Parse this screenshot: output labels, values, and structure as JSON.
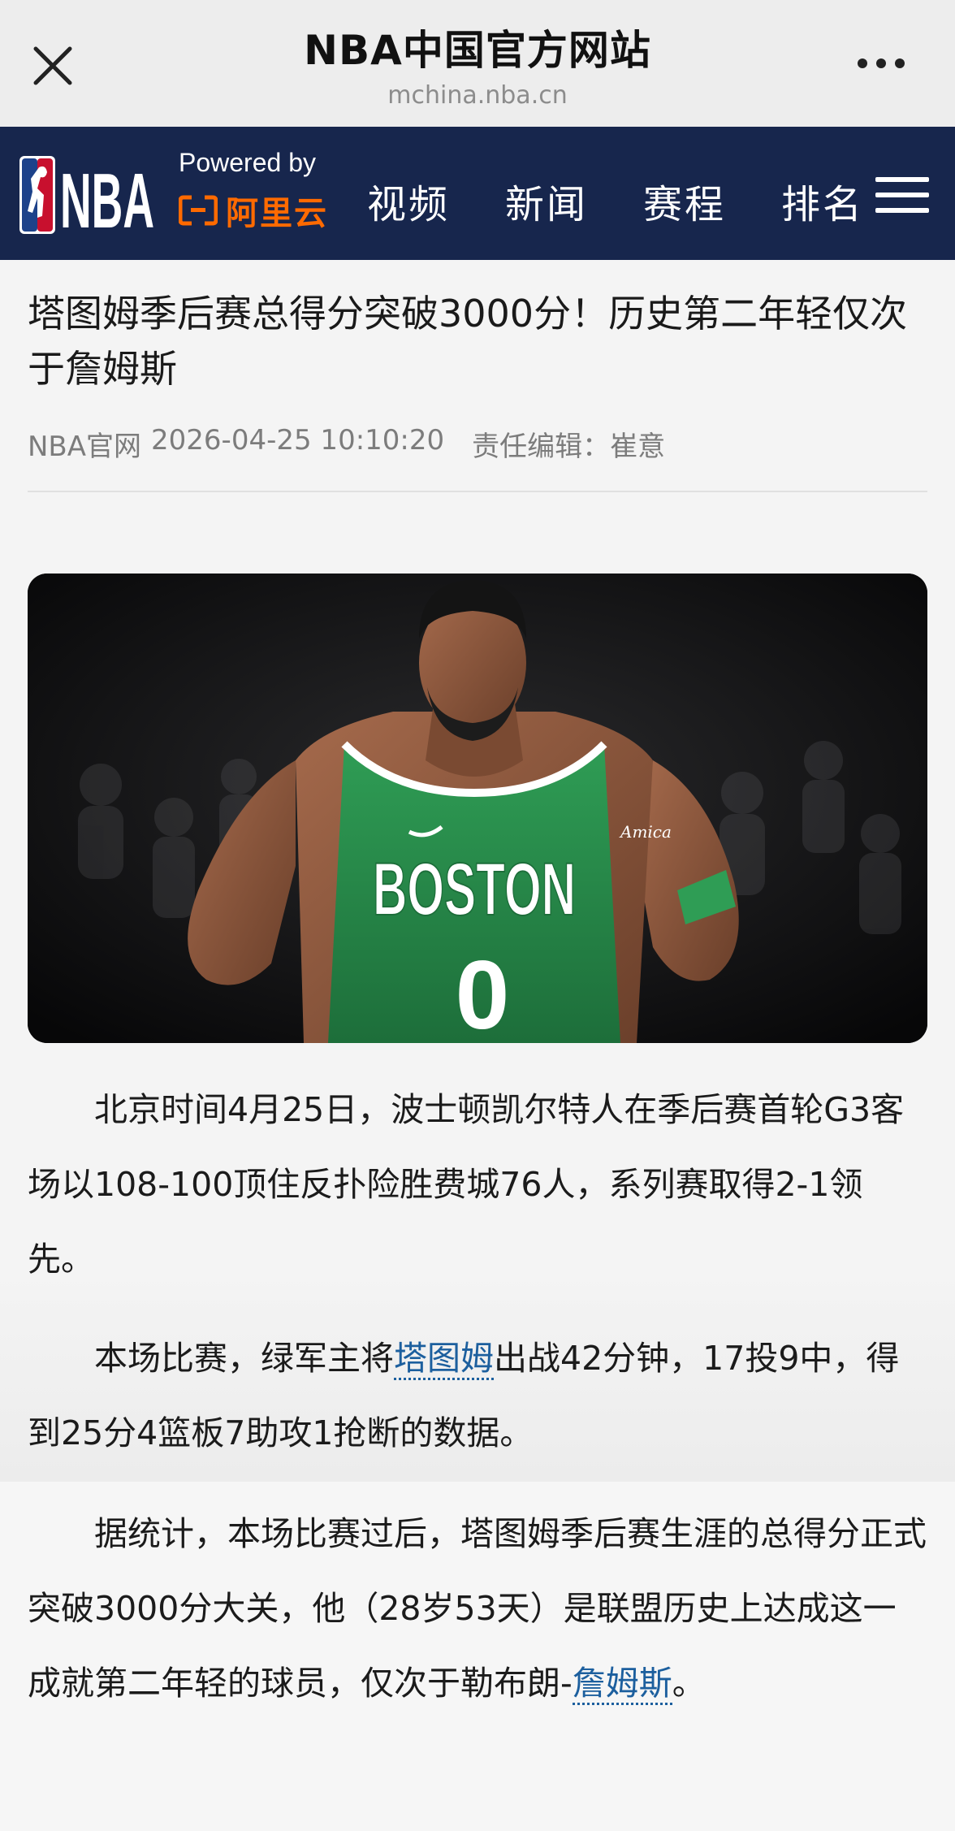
{
  "titlebar": {
    "close_icon": "close-icon",
    "title": "NBA中国官方网站",
    "url": "mchina.nba.cn",
    "more_icon": "more-dots-icon"
  },
  "navbar": {
    "logo": "NBA",
    "powered_by": "Powered by",
    "sponsor": "阿里云",
    "items": [
      {
        "label": "视频"
      },
      {
        "label": "新闻"
      },
      {
        "label": "赛程"
      },
      {
        "label": "排名"
      }
    ],
    "menu_icon": "hamburger-menu-icon",
    "colors": {
      "bar": "#17264d",
      "sponsor": "#ff6a00"
    }
  },
  "article": {
    "headline": "塔图姆季后赛总得分突破3000分！历史第二年轻仅次于詹姆斯",
    "source": "NBA官网",
    "datetime": "2026-04-25 10:10:20",
    "editor": "责任编辑：崔意",
    "image_caption_text": "Amica",
    "jersey_team": "BOSTON",
    "jersey_number": "0",
    "p1": "北京时间4月25日，波士顿凯尔特人在季后赛首轮G3客场以108-100顶住反扑险胜费城76人，系列赛取得2-1领先。",
    "p2_before": "本场比赛，绿军主将",
    "p2_link": "塔图姆",
    "p2_after": "出战42分钟，17投9中，得到25分4篮板7助攻1抢断的数据。",
    "p3_before": "据统计，本场比赛过后，塔图姆季后赛生涯的总得分正式突破3000分大关，他（28岁53天）是联盟历史上达成这一成就第二年轻的球员，仅次于勒布朗-",
    "p3_link": "詹姆斯",
    "p3_after": "。",
    "link_color": "#1c5f9e"
  }
}
